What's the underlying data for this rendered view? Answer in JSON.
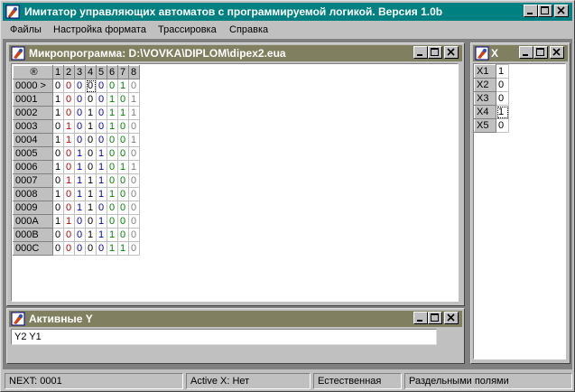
{
  "app": {
    "title": "Имитатор управляющих автоматов с программируемой логикой. Версия 1.0b"
  },
  "menu": [
    "Файлы",
    "Настройка формата",
    "Трассировка",
    "Справка"
  ],
  "microprogram": {
    "title": "Микропрограмма: D:\\VOVKA\\DIPLOM\\dipex2.eua",
    "corner": "®",
    "columns": [
      "1",
      "2",
      "3",
      "4",
      "5",
      "6",
      "7",
      "8"
    ],
    "rows": [
      {
        "addr": "0000 >",
        "bits": [
          "0",
          "0",
          "0",
          "0",
          "0",
          "0",
          "1",
          "0"
        ]
      },
      {
        "addr": "0001",
        "bits": [
          "1",
          "0",
          "0",
          "0",
          "0",
          "1",
          "0",
          "1"
        ]
      },
      {
        "addr": "0002",
        "bits": [
          "1",
          "0",
          "0",
          "1",
          "0",
          "1",
          "1",
          "1"
        ]
      },
      {
        "addr": "0003",
        "bits": [
          "0",
          "1",
          "0",
          "1",
          "0",
          "1",
          "0",
          "0"
        ]
      },
      {
        "addr": "0004",
        "bits": [
          "1",
          "1",
          "0",
          "0",
          "0",
          "0",
          "0",
          "1"
        ]
      },
      {
        "addr": "0005",
        "bits": [
          "0",
          "0",
          "1",
          "0",
          "1",
          "0",
          "0",
          "0"
        ]
      },
      {
        "addr": "0006",
        "bits": [
          "1",
          "0",
          "1",
          "0",
          "1",
          "0",
          "1",
          "1"
        ]
      },
      {
        "addr": "0007",
        "bits": [
          "0",
          "1",
          "1",
          "1",
          "1",
          "0",
          "0",
          "0"
        ]
      },
      {
        "addr": "0008",
        "bits": [
          "1",
          "0",
          "1",
          "1",
          "1",
          "1",
          "0",
          "0"
        ]
      },
      {
        "addr": "0009",
        "bits": [
          "0",
          "0",
          "1",
          "1",
          "0",
          "0",
          "0",
          "0"
        ]
      },
      {
        "addr": "000A",
        "bits": [
          "1",
          "1",
          "0",
          "0",
          "1",
          "0",
          "0",
          "0"
        ]
      },
      {
        "addr": "000B",
        "bits": [
          "0",
          "0",
          "0",
          "1",
          "1",
          "1",
          "0",
          "0"
        ]
      },
      {
        "addr": "000C",
        "bits": [
          "0",
          "0",
          "0",
          "0",
          "0",
          "1",
          "1",
          "0"
        ]
      }
    ]
  },
  "active_y": {
    "title": "Активные Y",
    "value": "Y2 Y1"
  },
  "x_window": {
    "title": "X",
    "rows": [
      {
        "label": "X1",
        "value": "1"
      },
      {
        "label": "X2",
        "value": "0"
      },
      {
        "label": "X3",
        "value": "0"
      },
      {
        "label": "X4",
        "value": "1"
      },
      {
        "label": "X5",
        "value": "0"
      }
    ]
  },
  "status": {
    "next": "NEXT: 0001",
    "activex": "Active X: Нет",
    "mode": "Естественная",
    "format": "Раздельными полями"
  }
}
